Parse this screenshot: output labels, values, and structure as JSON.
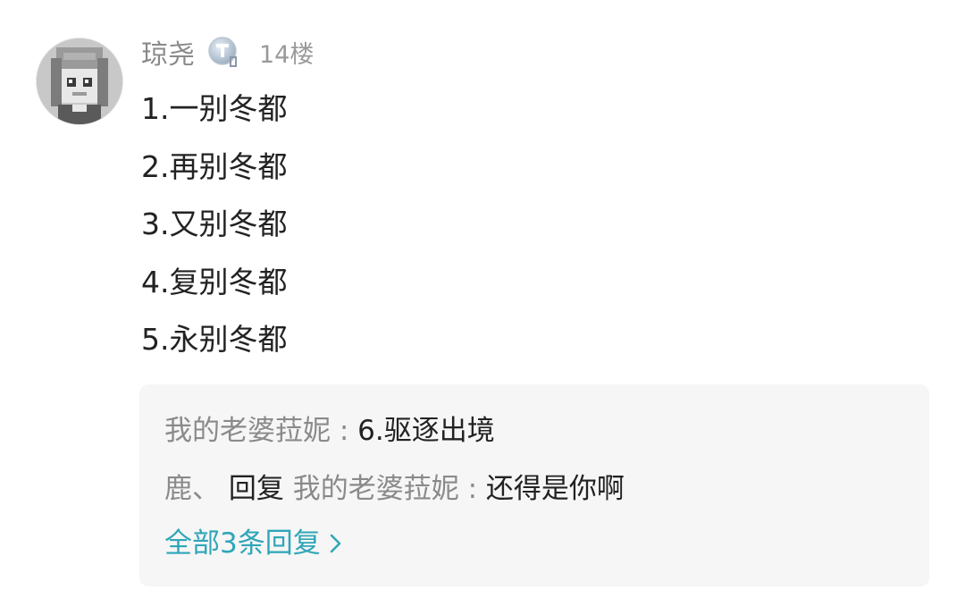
{
  "comment": {
    "username": "琼尧",
    "badge_icon": "t-level-badge-icon",
    "floor": "14楼",
    "lines": [
      "1.一别冬都",
      "2.再别冬都",
      "3.又别冬都",
      "4.复别冬都",
      "5.永别冬都"
    ]
  },
  "replies": {
    "items": [
      {
        "author": "我的老婆菈妮",
        "separator": ":",
        "content": "6.驱逐出境"
      },
      {
        "author": "鹿、",
        "reply_word": "回复",
        "target": "我的老婆菈妮",
        "separator": ":",
        "content": "还得是你啊"
      }
    ],
    "view_all_label": "全部3条回复",
    "view_all_icon": "chevron-right-icon",
    "accent_color": "#2fa6b8"
  }
}
